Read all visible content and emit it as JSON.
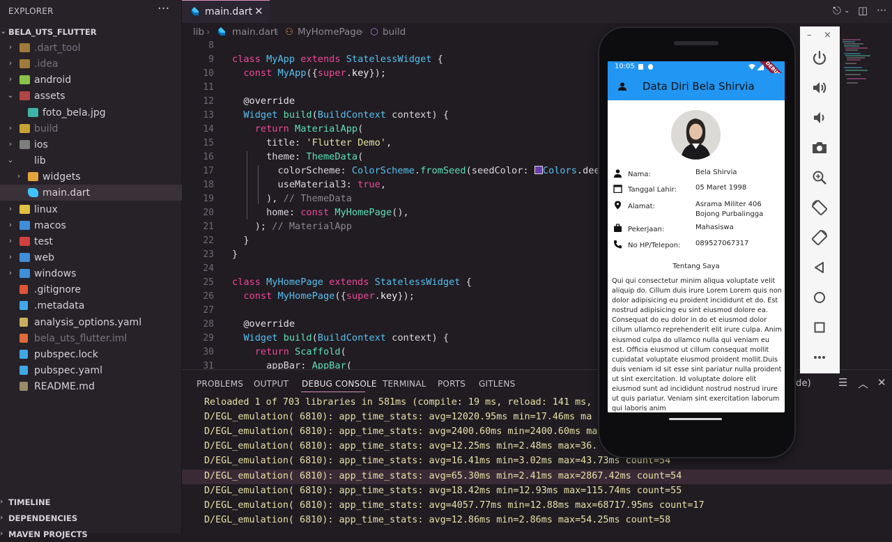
{
  "explorer": {
    "title": "EXPLORER",
    "more": "···",
    "root": "BELA_UTS_FLUTTER",
    "items": [
      {
        "label": ".dart_tool",
        "kind": "folder",
        "chev": "›",
        "indent": 0,
        "dim": true,
        "icon_color": "#a07a3a"
      },
      {
        "label": ".idea",
        "kind": "folder",
        "chev": "›",
        "indent": 0,
        "dim": true,
        "icon_color": "#a07a3a"
      },
      {
        "label": "android",
        "kind": "folder",
        "chev": "›",
        "indent": 0,
        "dim": false,
        "icon_color": "#8bc34a"
      },
      {
        "label": "assets",
        "kind": "folder",
        "chev": "⌄",
        "indent": 0,
        "dim": false,
        "icon_color": "#b04545"
      },
      {
        "label": "foto_bela.jpg",
        "kind": "image",
        "chev": "",
        "indent": 1,
        "dim": false,
        "icon_color": "#3fb3a6"
      },
      {
        "label": "build",
        "kind": "folder",
        "chev": "›",
        "indent": 0,
        "dim": true,
        "icon_color": "#c8a233"
      },
      {
        "label": "ios",
        "kind": "folder",
        "chev": "›",
        "indent": 0,
        "dim": false,
        "icon_color": "#7e7e7e"
      },
      {
        "label": "lib",
        "kind": "folder",
        "chev": "⌄",
        "indent": 0,
        "dim": false,
        "icon_color": ""
      },
      {
        "label": "widgets",
        "kind": "folder",
        "chev": "›",
        "indent": 1,
        "dim": false,
        "icon_color": "#e6a23c"
      },
      {
        "label": "main.dart",
        "kind": "dart",
        "chev": "",
        "indent": 1,
        "dim": false,
        "icon_color": "#40c4ff",
        "active": true
      },
      {
        "label": "linux",
        "kind": "folder",
        "chev": "›",
        "indent": 0,
        "dim": false,
        "icon_color": "#e0c040"
      },
      {
        "label": "macos",
        "kind": "folder",
        "chev": "›",
        "indent": 0,
        "dim": false,
        "icon_color": "#3f8fd8"
      },
      {
        "label": "test",
        "kind": "folder",
        "chev": "›",
        "indent": 0,
        "dim": false,
        "icon_color": "#d04040"
      },
      {
        "label": "web",
        "kind": "folder",
        "chev": "›",
        "indent": 0,
        "dim": false,
        "icon_color": "#3f8fd8"
      },
      {
        "label": "windows",
        "kind": "folder",
        "chev": "›",
        "indent": 0,
        "dim": false,
        "icon_color": "#3f8fd8"
      },
      {
        "label": ".gitignore",
        "kind": "file",
        "chev": "",
        "indent": 0,
        "dim": false,
        "icon_color": "#e0533a"
      },
      {
        "label": ".metadata",
        "kind": "file",
        "chev": "",
        "indent": 0,
        "dim": false,
        "icon_color": "#40a8e8"
      },
      {
        "label": "analysis_options.yaml",
        "kind": "file",
        "chev": "",
        "indent": 0,
        "dim": false,
        "icon_color": "#c8b060"
      },
      {
        "label": "bela_uts_flutter.iml",
        "kind": "file",
        "chev": "",
        "indent": 0,
        "dim": true,
        "icon_color": "#e06a3a"
      },
      {
        "label": "pubspec.lock",
        "kind": "file",
        "chev": "",
        "indent": 0,
        "dim": false,
        "icon_color": "#40a8e8"
      },
      {
        "label": "pubspec.yaml",
        "kind": "file",
        "chev": "",
        "indent": 0,
        "dim": false,
        "icon_color": "#40a8e8"
      },
      {
        "label": "README.md",
        "kind": "file",
        "chev": "",
        "indent": 0,
        "dim": false,
        "icon_color": "#9a8a6a"
      }
    ],
    "sections": [
      "TIMELINE",
      "DEPENDENCIES",
      "MAVEN PROJECTS"
    ]
  },
  "editor": {
    "tab": "main.dart",
    "breadcrumb": [
      "lib",
      "main.dart",
      "MyHomePage",
      "build"
    ],
    "line_numbers": [
      "8",
      "9",
      "10",
      "11",
      "12",
      "13",
      "14",
      "15",
      "16",
      "17",
      "18",
      "19",
      "20",
      "21",
      "22",
      "23",
      "24",
      "25",
      "26",
      "27",
      "28",
      "29",
      "30",
      "31"
    ]
  },
  "panel": {
    "tabs": [
      "PROBLEMS",
      "OUTPUT",
      "DEBUG CONSOLE",
      "TERMINAL",
      "PORTS",
      "GITLENS"
    ],
    "active_tab": "DEBUG CONSOLE",
    "filter_tail": "de)",
    "lines": [
      "Reloaded 1 of 703 libraries in 581ms (compile: 19 ms, reload: 141 ms,",
      "D/EGL_emulation( 6810): app_time_stats: avg=12020.95ms min=17.46ms ma",
      "D/EGL_emulation( 6810): app_time_stats: avg=2400.60ms min=2400.60ms ma",
      "D/EGL_emulation( 6810): app_time_stats: avg=12.25ms min=2.48ms max=36.",
      "D/EGL_emulation( 6810): app_time_stats: avg=16.41ms min=3.02ms max=43.73ms count=54",
      "D/EGL_emulation( 6810): app_time_stats: avg=65.30ms min=2.41ms max=2867.42ms count=54",
      "D/EGL_emulation( 6810): app_time_stats: avg=18.42ms min=12.93ms max=115.74ms count=55",
      "D/EGL_emulation( 6810): app_time_stats: avg=4057.77ms min=12.88ms max=68717.95ms count=17",
      "D/EGL_emulation( 6810): app_time_stats: avg=12.86ms min=2.86ms max=54.25ms count=58"
    ]
  },
  "phone": {
    "time": "10:05",
    "debug": "DEBUG",
    "app_title": "Data Diri Bela Shirvia",
    "info": [
      {
        "label": "Nama:",
        "value": "Bela Shirvia",
        "icon": "person-icon"
      },
      {
        "label": "Tanggal Lahir:",
        "value": "05 Maret 1998",
        "icon": "calendar-icon"
      },
      {
        "label": "Alamat:",
        "value": "Asrama Militer 406\nBojong Purbalingga",
        "icon": "location-icon"
      },
      {
        "label": "Pekerjaan:",
        "value": "Mahasiswa",
        "icon": "work-icon"
      },
      {
        "label": "No HP/Telepon:",
        "value": "089527067317",
        "icon": "phone-icon"
      }
    ],
    "about_title": "Tentang Saya",
    "about_text": "Qui qui consectetur minim aliqua voluptate velit aliquip do. Cillum duis irure Lorem Lorem quis non dolor adipisicing eu proident incididunt et do. Est nostrud adipisicing eu sint eiusmod dolore ea. Consequat do eu dolor in do et eiusmod dolor cillum ullamco reprehenderit elit irure culpa. Anim eiusmod culpa do ullamco nulla qui veniam eu est. Officia eiusmod ut cillum consequat mollit cupidatat voluptate eiusmod proident mollit.Duis duis veniam id sit esse sint pariatur nulla proident ut sint exercitation. Id voluptate dolore elit eiusmod sunt ad incididunt nostrud nostrud irure ut quis pariatur. Veniam sint exercitation laborum qui laboris anim"
  },
  "emulator": {
    "minimize": "–",
    "close": "×",
    "buttons": [
      "power-icon",
      "volume-up-icon",
      "volume-down-icon",
      "camera-icon",
      "zoom-icon",
      "rotate-left-icon",
      "rotate-right-icon",
      "back-icon",
      "home-icon",
      "overview-icon",
      "more-icon"
    ]
  }
}
